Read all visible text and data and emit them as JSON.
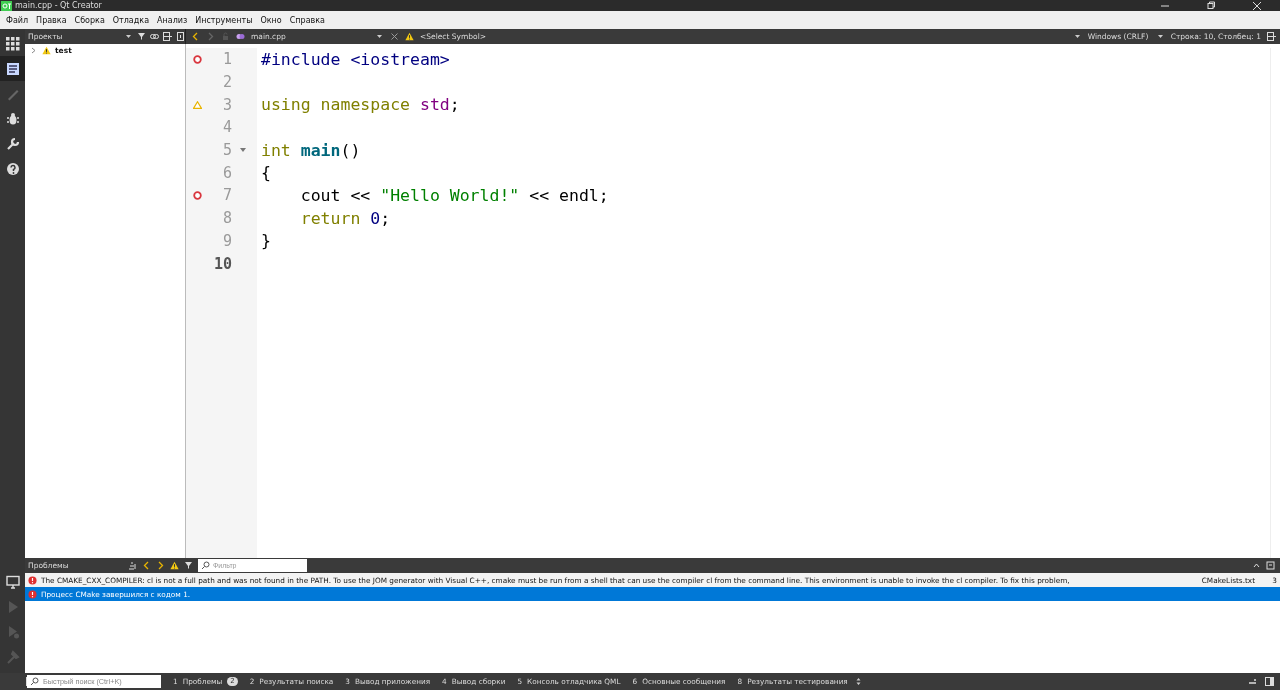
{
  "window": {
    "title": "main.cpp - Qt Creator"
  },
  "menu": [
    "Файл",
    "Правка",
    "Сборка",
    "Отладка",
    "Анализ",
    "Инструменты",
    "Окно",
    "Справка"
  ],
  "modes": [
    {
      "kind": "welcome",
      "selected": false,
      "disabled": false
    },
    {
      "kind": "edit",
      "selected": true,
      "disabled": false
    },
    {
      "kind": "design",
      "selected": false,
      "disabled": true
    },
    {
      "kind": "debug",
      "selected": false,
      "disabled": false
    },
    {
      "kind": "projects",
      "selected": false,
      "disabled": false
    },
    {
      "kind": "help",
      "selected": false,
      "disabled": false
    }
  ],
  "run_controls": [
    {
      "kind": "device"
    },
    {
      "kind": "run"
    },
    {
      "kind": "debug"
    },
    {
      "kind": "build"
    }
  ],
  "projects": {
    "title": "Проекты",
    "items": [
      {
        "label": "test",
        "warning": true,
        "expanded": false
      }
    ]
  },
  "editor": {
    "file": "main.cpp",
    "symbol": "<Select Symbol>",
    "line_ending": "Windows (CRLF)",
    "position": "Строка: 10, Столбец: 1",
    "lines": [
      {
        "number": "1",
        "error_mark": true,
        "warning_mark": false,
        "fold": false,
        "current": false,
        "tokens": [
          {
            "kind": "preproc",
            "text": "#include <iostream>"
          }
        ]
      },
      {
        "number": "2",
        "error_mark": false,
        "warning_mark": false,
        "fold": false,
        "current": false
      },
      {
        "number": "3",
        "error_mark": false,
        "warning_mark": true,
        "fold": false,
        "current": false,
        "tokens": [
          {
            "kind": "keyword",
            "text": "using namespace "
          },
          {
            "kind": "namespace",
            "text": "std"
          },
          {
            "kind": "plain",
            "text": ";"
          }
        ]
      },
      {
        "number": "4",
        "error_mark": false,
        "warning_mark": false,
        "fold": false,
        "current": false
      },
      {
        "number": "5",
        "error_mark": false,
        "warning_mark": false,
        "fold": true,
        "current": false,
        "tokens": [
          {
            "kind": "keyword",
            "text": "int "
          },
          {
            "kind": "function",
            "text": "main"
          },
          {
            "kind": "plain",
            "text": "()"
          }
        ]
      },
      {
        "number": "6",
        "error_mark": false,
        "warning_mark": false,
        "fold": false,
        "current": false,
        "tokens": [
          {
            "kind": "plain",
            "text": "{"
          }
        ]
      },
      {
        "number": "7",
        "error_mark": true,
        "warning_mark": false,
        "fold": false,
        "current": false,
        "tokens": [
          {
            "kind": "plain",
            "text": "    cout << "
          },
          {
            "kind": "string",
            "text": "\"Hello World!\""
          },
          {
            "kind": "plain",
            "text": " << endl;"
          }
        ]
      },
      {
        "number": "8",
        "error_mark": false,
        "warning_mark": false,
        "fold": false,
        "current": false,
        "tokens": [
          {
            "kind": "keyword",
            "text": "    return "
          },
          {
            "kind": "number",
            "text": "0"
          },
          {
            "kind": "plain",
            "text": ";"
          }
        ]
      },
      {
        "number": "9",
        "error_mark": false,
        "warning_mark": false,
        "fold": false,
        "current": false,
        "tokens": [
          {
            "kind": "plain",
            "text": "}"
          }
        ]
      },
      {
        "number": "10",
        "error_mark": false,
        "warning_mark": false,
        "fold": false,
        "current": true
      }
    ]
  },
  "problems": {
    "title": "Проблемы",
    "filter": {
      "placeholder": "Фильтр"
    },
    "rows": [
      {
        "kind": "error",
        "selected": false,
        "text": "The CMAKE_CXX_COMPILER: cl is not a full path and was not found in the PATH. To use the JOM generator with Visual C++, cmake must be run from a shell that can use the compiler cl from the command line.  This environment is unable to invoke the cl compiler.  To fix this problem, ",
        "file": "CMakeLists.txt",
        "line": "3"
      },
      {
        "kind": "error",
        "selected": true,
        "text": "Процесс CMake завершился с кодом 1."
      }
    ]
  },
  "quick_search": {
    "placeholder": "Быстрый поиск (Ctrl+K)"
  },
  "output_tabs": [
    {
      "number": "1",
      "label": "Проблемы",
      "badge": "2",
      "selected": false
    },
    {
      "number": "2",
      "label": "Результаты поиска",
      "selected": false
    },
    {
      "number": "3",
      "label": "Вывод приложения",
      "selected": false
    },
    {
      "number": "4",
      "label": "Вывод сборки",
      "selected": false
    },
    {
      "number": "5",
      "label": "Консоль отладчика QML",
      "selected": false
    },
    {
      "number": "6",
      "label": "Основные сообщения",
      "selected": false
    },
    {
      "number": "8",
      "label": "Результаты тестирования",
      "selected": false
    }
  ]
}
